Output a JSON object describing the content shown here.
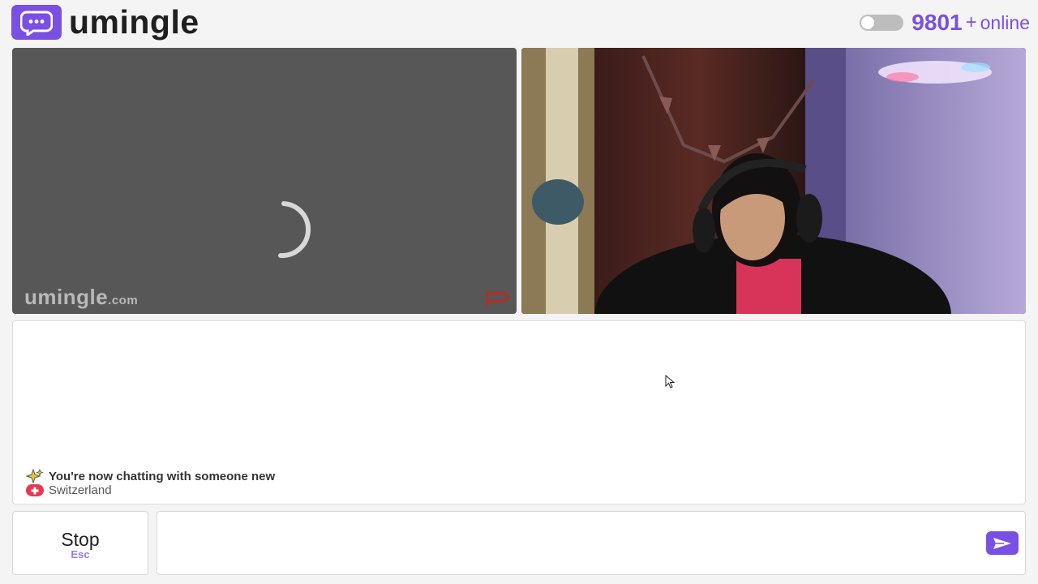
{
  "header": {
    "logo_text": "umingle",
    "online_count": "9801",
    "online_plus": "+",
    "online_label": "online"
  },
  "video": {
    "watermark_main": "umingle",
    "watermark_suffix": ".com"
  },
  "chat": {
    "status_message": "You're now chatting with someone new",
    "country": "Switzerland"
  },
  "controls": {
    "stop_label": "Stop",
    "stop_key": "Esc",
    "message_placeholder": ""
  },
  "colors": {
    "accent": "#7a4fe3",
    "video_bg": "#575757",
    "flag_red": "#e8384f"
  },
  "icons": {
    "logo": "chat-bubble-icon",
    "send": "send-arrow-icon",
    "report": "flag-icon",
    "sparkle": "sparkles-icon"
  }
}
